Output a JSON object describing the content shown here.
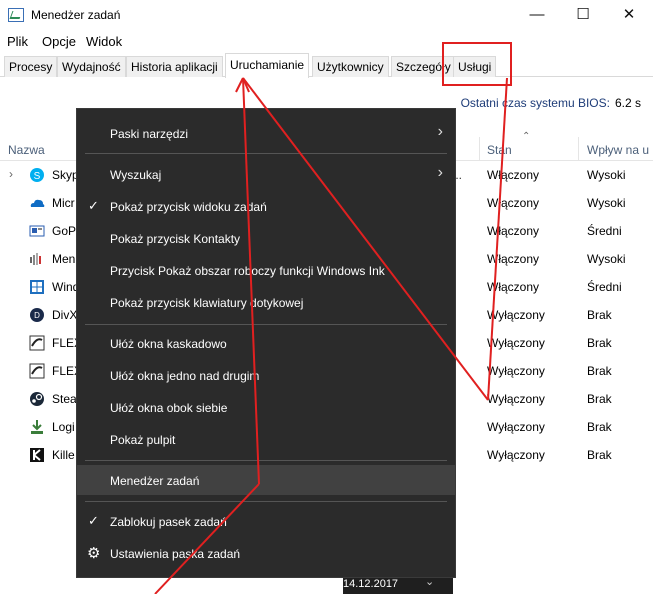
{
  "window": {
    "title": "Menedżer zadań",
    "minimize": "—",
    "maximize": "☐",
    "close": "✕"
  },
  "menubar": {
    "items": [
      {
        "label": "Plik"
      },
      {
        "label": "Opcje"
      },
      {
        "label": "Widok"
      }
    ]
  },
  "tabs": [
    {
      "label": "Procesy"
    },
    {
      "label": "Wydajność"
    },
    {
      "label": "Historia aplikacji"
    },
    {
      "label": "Uruchamianie",
      "active": true
    },
    {
      "label": "Użytkownicy"
    },
    {
      "label": "Szczegóły"
    },
    {
      "label": "Usługi"
    }
  ],
  "bios": {
    "label": "Ostatni czas systemu BIOS:",
    "value": "6.2 s"
  },
  "table": {
    "columns": {
      "name": "Nazwa",
      "status": "Stan",
      "impact": "Wpływ na u"
    },
    "rows": [
      {
        "name": "Skyp",
        "status": "Włączony",
        "impact": "Wysoki",
        "icon": "skype-icon"
      },
      {
        "name": "Micr",
        "status": "Włączony",
        "impact": "Wysoki",
        "icon": "onedrive-icon"
      },
      {
        "name": "GoP",
        "status": "Włączony",
        "impact": "Średni",
        "icon": "gopro-icon"
      },
      {
        "name": "Men",
        "status": "Włączony",
        "impact": "Wysoki",
        "icon": "audio-icon"
      },
      {
        "name": "Wind",
        "status": "Włączony",
        "impact": "Średni",
        "icon": "windows-icon"
      },
      {
        "name": "DivX",
        "status": "Wyłączony",
        "impact": "Brak",
        "icon": "divx-icon"
      },
      {
        "name": "FLEX",
        "status": "Wyłączony",
        "impact": "Brak",
        "icon": "flex-icon"
      },
      {
        "name": "FLEX",
        "status": "Wyłączony",
        "impact": "Brak",
        "icon": "flex-icon"
      },
      {
        "name": "Stea",
        "status": "Wyłączony",
        "impact": "Brak",
        "icon": "steam-icon"
      },
      {
        "name": "Logi",
        "status": "Wyłączony",
        "impact": "Brak",
        "icon": "download-icon"
      },
      {
        "name": "Kille",
        "status": "Wyłączony",
        "impact": "Brak",
        "icon": "killer-icon"
      }
    ],
    "truncated_mark": "..."
  },
  "context_menu": {
    "toolbars": "Paski narzędzi",
    "search": "Wyszukaj",
    "show_task_view": "Pokaż przycisk widoku zadań",
    "show_contacts": "Pokaż przycisk Kontakty",
    "show_ink": "Przycisk Pokaż obszar roboczy funkcji Windows Ink",
    "show_keyboard": "Pokaż przycisk klawiatury dotykowej",
    "cascade": "Ułóż okna kaskadowo",
    "stacked": "Ułóż okna jedno nad drugim",
    "side_by_side": "Ułóż okna obok siebie",
    "show_desktop": "Pokaż pulpit",
    "task_manager": "Menedżer zadań",
    "lock_taskbar": "Zablokuj pasek zadań",
    "taskbar_settings": "Ustawienia paska zadań"
  },
  "taskbar": {
    "date": "14.12.2017"
  },
  "colors": {
    "annotation": "#e02020",
    "menu_bg": "#2b2b2b",
    "link_blue": "#1e3c78"
  }
}
